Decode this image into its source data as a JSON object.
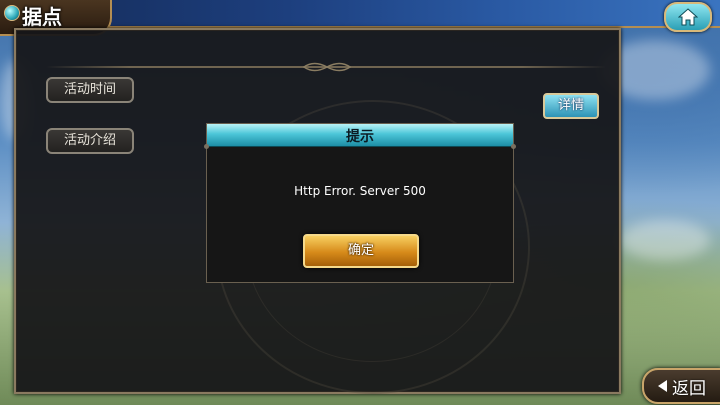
{
  "header": {
    "title": "据点"
  },
  "sidebar": {
    "items": [
      {
        "label": "活动时间"
      },
      {
        "label": "活动介绍"
      }
    ]
  },
  "detail_button": {
    "label": "详情"
  },
  "dialog": {
    "title": "提示",
    "message": "Http Error. Server 500",
    "confirm_label": "确定"
  },
  "footer": {
    "back_label": "返回"
  },
  "icons": {
    "home": "home-icon",
    "back": "back-arrow-icon"
  },
  "colors": {
    "accent_cyan": "#2aa5b5",
    "confirm_gold": "#d68a1a",
    "panel_bg": "#161618",
    "border_gold": "#b48e52"
  }
}
